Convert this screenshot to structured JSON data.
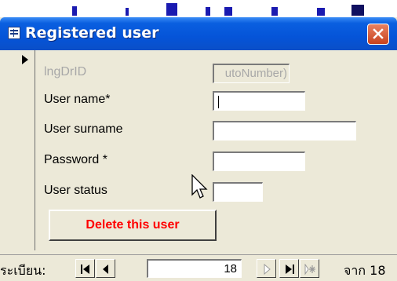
{
  "window": {
    "title": "Registered user",
    "title_icon": "form-icon",
    "close_icon": "close-icon"
  },
  "form": {
    "fields": [
      {
        "label": "lngDrID",
        "value": "utoNumber)",
        "disabled": true
      },
      {
        "label": "User name*",
        "value": "",
        "disabled": false
      },
      {
        "label": "User surname",
        "value": "",
        "disabled": false
      },
      {
        "label": "Password *",
        "value": "",
        "disabled": false
      },
      {
        "label": "User status",
        "value": "",
        "disabled": false
      }
    ],
    "delete_button": "Delete this user",
    "delete_button_color": "#ff0000"
  },
  "navigation": {
    "record_label": "ระเบียน:",
    "current_record": "18",
    "of_label": "จาก 18",
    "buttons": [
      "first-record-icon",
      "previous-record-icon",
      "next-record-icon",
      "last-record-icon",
      "new-record-icon"
    ]
  },
  "colors": {
    "titlebar": "#0554d8",
    "close": "#d85a33",
    "face": "#ece9d8"
  }
}
